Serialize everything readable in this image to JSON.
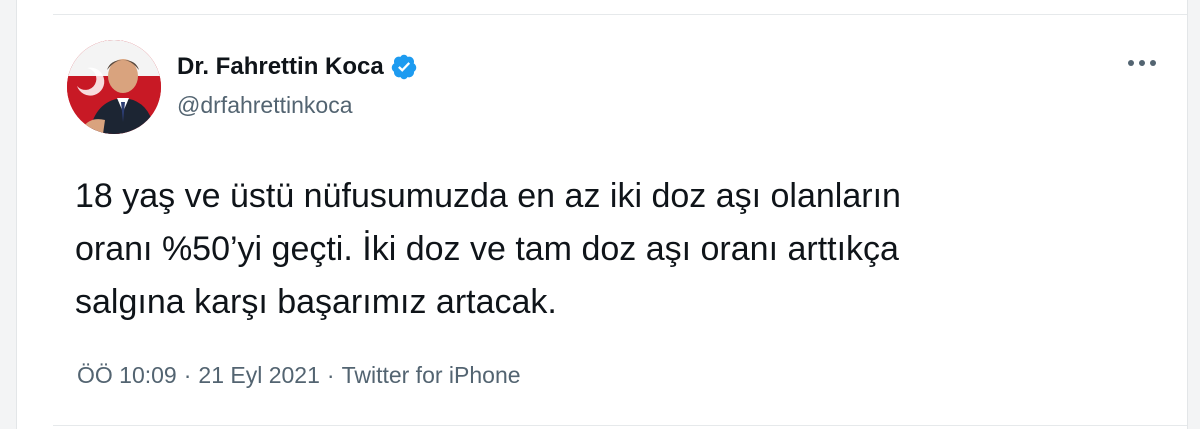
{
  "author": {
    "name": "Dr. Fahrettin Koca",
    "handle": "@drfahrettinkoca",
    "verified": true
  },
  "tweet": {
    "text_lines": [
      "18 yaş ve üstü nüfusumuzda en az iki doz aşı olanların",
      "oranı %50’yi geçti. İki doz ve tam doz aşı oranı arttıkça",
      "salgına karşı başarımız artacak."
    ]
  },
  "meta": {
    "time": "ÖÖ 10:09",
    "separator": "·",
    "date": "21 Eyl 2021",
    "source": "Twitter for iPhone"
  },
  "icons": {
    "verified": "verified-badge-icon",
    "more": "more-options-icon"
  },
  "colors": {
    "verified": "#1d9bf0",
    "text_primary": "#0f1419",
    "text_secondary": "#536471"
  }
}
